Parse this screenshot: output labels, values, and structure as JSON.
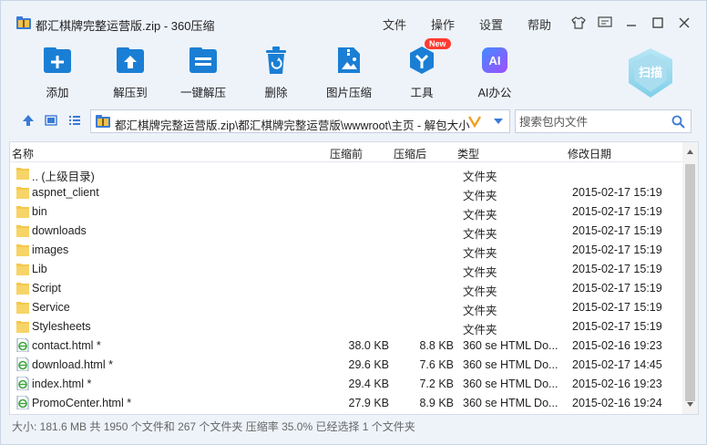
{
  "window": {
    "title": "都汇棋牌完整运营版.zip - 360压缩",
    "menus": [
      "文件",
      "操作",
      "设置",
      "帮助"
    ]
  },
  "toolbar": {
    "buttons": [
      {
        "label": "添加",
        "icon": "add-icon"
      },
      {
        "label": "解压到",
        "icon": "extract-to-icon"
      },
      {
        "label": "一键解压",
        "icon": "one-click-extract-icon"
      },
      {
        "label": "删除",
        "icon": "trash-icon"
      },
      {
        "label": "图片压缩",
        "icon": "image-compress-icon"
      },
      {
        "label": "工具",
        "icon": "tools-icon"
      },
      {
        "label": "AI办公",
        "icon": "ai-office-icon"
      }
    ],
    "new_badge": "New",
    "scan_label": "扫描",
    "ai_icon_text": "AI"
  },
  "address": {
    "path": "都汇棋牌完整运营版.zip\\都汇棋牌完整运营版\\wwwroot\\主页 - 解包大小",
    "search_placeholder": "搜索包内文件"
  },
  "columns": {
    "name": "名称",
    "compressed": "压缩前",
    "packed": "压缩后",
    "type": "类型",
    "modified": "修改日期"
  },
  "files": [
    {
      "name": ".. (上级目录)",
      "kind": "folder",
      "compressed": "",
      "packed": "",
      "type": "文件夹",
      "date": ""
    },
    {
      "name": "aspnet_client",
      "kind": "folder",
      "compressed": "",
      "packed": "",
      "type": "文件夹",
      "date": "2015-02-17 15:19"
    },
    {
      "name": "bin",
      "kind": "folder",
      "compressed": "",
      "packed": "",
      "type": "文件夹",
      "date": "2015-02-17 15:19"
    },
    {
      "name": "downloads",
      "kind": "folder",
      "compressed": "",
      "packed": "",
      "type": "文件夹",
      "date": "2015-02-17 15:19"
    },
    {
      "name": "images",
      "kind": "folder",
      "compressed": "",
      "packed": "",
      "type": "文件夹",
      "date": "2015-02-17 15:19"
    },
    {
      "name": "Lib",
      "kind": "folder",
      "compressed": "",
      "packed": "",
      "type": "文件夹",
      "date": "2015-02-17 15:19"
    },
    {
      "name": "Script",
      "kind": "folder",
      "compressed": "",
      "packed": "",
      "type": "文件夹",
      "date": "2015-02-17 15:19"
    },
    {
      "name": "Service",
      "kind": "folder",
      "compressed": "",
      "packed": "",
      "type": "文件夹",
      "date": "2015-02-17 15:19"
    },
    {
      "name": "Stylesheets",
      "kind": "folder",
      "compressed": "",
      "packed": "",
      "type": "文件夹",
      "date": "2015-02-17 15:19"
    },
    {
      "name": "contact.html *",
      "kind": "html",
      "compressed": "38.0 KB",
      "packed": "8.8 KB",
      "type": "360 se HTML Do...",
      "date": "2015-02-16 19:23"
    },
    {
      "name": "download.html *",
      "kind": "html",
      "compressed": "29.6 KB",
      "packed": "7.6 KB",
      "type": "360 se HTML Do...",
      "date": "2015-02-17 14:45"
    },
    {
      "name": "index.html *",
      "kind": "html",
      "compressed": "29.4 KB",
      "packed": "7.2 KB",
      "type": "360 se HTML Do...",
      "date": "2015-02-16 19:23"
    },
    {
      "name": "PromoCenter.html *",
      "kind": "html",
      "compressed": "27.9 KB",
      "packed": "8.9 KB",
      "type": "360 se HTML Do...",
      "date": "2015-02-16 19:24"
    }
  ],
  "status": "大小: 181.6 MB 共 1950 个文件和 267 个文件夹 压缩率 35.0% 已经选择 1 个文件夹",
  "colors": {
    "accent": "#1a7fd4",
    "folder": "#f5c84c",
    "badge": "#ff3b30"
  }
}
